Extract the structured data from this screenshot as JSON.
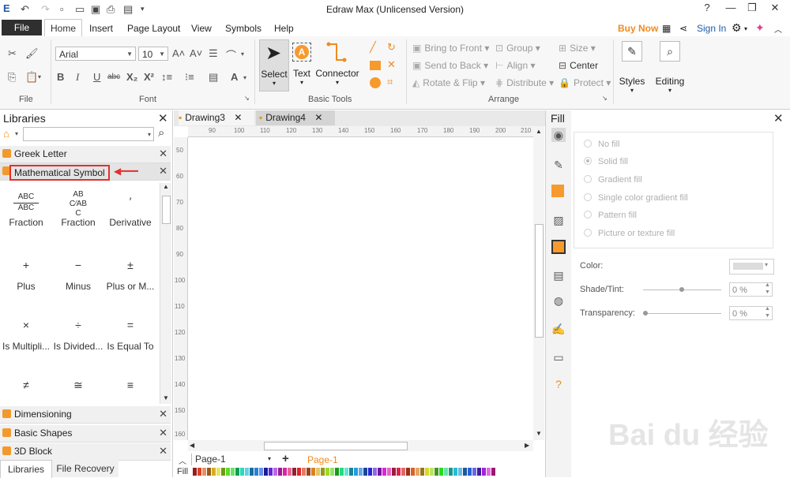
{
  "app": {
    "title": "Edraw Max (Unlicensed Version)",
    "menu": [
      "File",
      "Home",
      "Insert",
      "Page Layout",
      "View",
      "Symbols",
      "Help"
    ],
    "active_menu": "Home",
    "buy_now": "Buy Now",
    "sign_in": "Sign In",
    "window_buttons": [
      "?",
      "—",
      "❐",
      "✕"
    ]
  },
  "ribbon": {
    "groups": {
      "file": "File",
      "font": "Font",
      "basic_tools": "Basic Tools",
      "arrange": "Arrange"
    },
    "font_name": "Arial",
    "font_size": "10",
    "font_buttons": [
      "B",
      "I",
      "U",
      "abc",
      "X₂",
      "X²"
    ],
    "tools": {
      "select": "Select",
      "text": "Text",
      "connector": "Connector"
    },
    "arrange": {
      "bring_to_front": "Bring to Front",
      "send_to_back": "Send to Back",
      "rotate_flip": "Rotate & Flip",
      "group": "Group",
      "align": "Align",
      "distribute": "Distribute",
      "size": "Size",
      "center": "Center",
      "protect": "Protect"
    },
    "styles": "Styles",
    "editing": "Editing"
  },
  "libraries": {
    "title": "Libraries",
    "search_placeholder": "",
    "categories": {
      "greek": "Greek Letter",
      "math": "Mathematical Symbol",
      "dimensioning": "Dimensioning",
      "basic_shapes": "Basic Shapes",
      "block3d": "3D Block"
    },
    "symbols": [
      {
        "glyph": "ABC/ABC",
        "name": "Fraction"
      },
      {
        "glyph": "AB/C",
        "name": "Fraction"
      },
      {
        "glyph": "′",
        "name": "Derivative"
      },
      {
        "glyph": "+",
        "name": "Plus"
      },
      {
        "glyph": "−",
        "name": "Minus"
      },
      {
        "glyph": "±",
        "name": "Plus or M..."
      },
      {
        "glyph": "×",
        "name": "Is Multipli..."
      },
      {
        "glyph": "÷",
        "name": "Is Divided..."
      },
      {
        "glyph": "=",
        "name": "Is Equal To"
      },
      {
        "glyph": "≠",
        "name": ""
      },
      {
        "glyph": "≅",
        "name": ""
      },
      {
        "glyph": "≡",
        "name": ""
      }
    ],
    "bottom_tabs": [
      "Libraries",
      "File Recovery"
    ]
  },
  "canvas": {
    "tabs": [
      "Drawing3",
      "Drawing4"
    ],
    "active_tab": "Drawing4",
    "ruler_top": [
      "90",
      "100",
      "110",
      "120",
      "130",
      "140",
      "150",
      "160",
      "170",
      "180",
      "190",
      "200",
      "210"
    ],
    "ruler_left": [
      "50",
      "60",
      "70",
      "80",
      "90",
      "100",
      "110",
      "120",
      "130",
      "140",
      "150",
      "160"
    ],
    "page_selector": "Page-1",
    "page_tab": "Page-1",
    "fill_label": "Fill"
  },
  "fill_panel": {
    "title": "Fill",
    "options": [
      "No fill",
      "Solid fill",
      "Gradient fill",
      "Single color gradient fill",
      "Pattern fill",
      "Picture or texture fill"
    ],
    "color_label": "Color:",
    "shade_label": "Shade/Tint:",
    "shade_value": "0 %",
    "transparency_label": "Transparency:",
    "transparency_value": "0 %",
    "accent_color": "#f79a2e"
  },
  "watermark": "Bai du 经验"
}
